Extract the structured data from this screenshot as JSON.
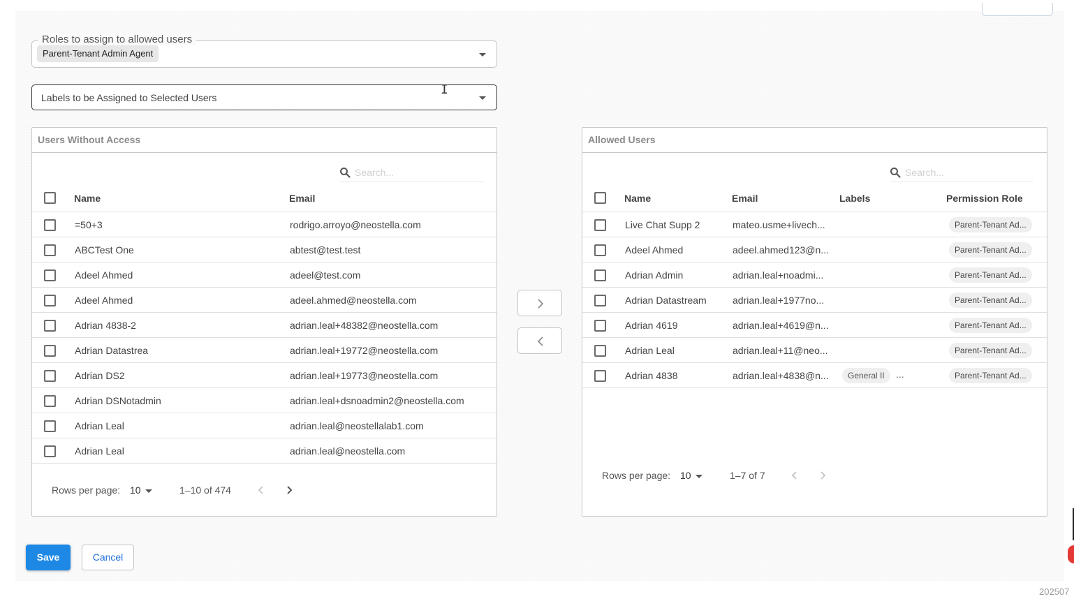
{
  "roles_field": {
    "legend": "Roles to assign to allowed users",
    "selected_chip": "Parent-Tenant Admin Agent"
  },
  "labels_field": {
    "placeholder": "Labels to be Assigned to Selected Users"
  },
  "left_panel": {
    "title": "Users Without Access",
    "search_placeholder": "Search...",
    "columns": [
      "Name",
      "Email"
    ],
    "rows": [
      {
        "name": "=50+3",
        "email": "rodrigo.arroyo@neostella.com"
      },
      {
        "name": "ABCTest One",
        "email": "abtest@test.test"
      },
      {
        "name": "Adeel Ahmed",
        "email": "adeel@test.com"
      },
      {
        "name": "Adeel Ahmed",
        "email": "adeel.ahmed@neostella.com"
      },
      {
        "name": "Adrian 4838-2",
        "email": "adrian.leal+48382@neostella.com"
      },
      {
        "name": "Adrian Datastrea",
        "email": "adrian.leal+19772@neostella.com"
      },
      {
        "name": "Adrian DS2",
        "email": "adrian.leal+19773@neostella.com"
      },
      {
        "name": "Adrian DSNotadmin",
        "email": "adrian.leal+dsnoadmin2@neostella.com"
      },
      {
        "name": "Adrian Leal",
        "email": "adrian.leal@neostellalab1.com"
      },
      {
        "name": "Adrian Leal",
        "email": "adrian.leal@neostella.com"
      }
    ],
    "rows_per_page_label": "Rows per page:",
    "rows_per_page": "10",
    "range": "1–10 of 474"
  },
  "right_panel": {
    "title": "Allowed Users",
    "search_placeholder": "Search...",
    "columns": [
      "Name",
      "Email",
      "Labels",
      "Permission Role"
    ],
    "rows": [
      {
        "name": "Live Chat Supp 2",
        "email": "mateo.usme+livech...",
        "label": "",
        "role": "Parent-Tenant Ad..."
      },
      {
        "name": "Adeel Ahmed",
        "email": "adeel.ahmed123@n...",
        "label": "",
        "role": "Parent-Tenant Ad..."
      },
      {
        "name": "Adrian Admin",
        "email": "adrian.leal+noadmi...",
        "label": "",
        "role": "Parent-Tenant Ad..."
      },
      {
        "name": "Adrian Datastream",
        "email": "adrian.leal+1977no...",
        "label": "",
        "role": "Parent-Tenant Ad..."
      },
      {
        "name": "Adrian 4619",
        "email": "adrian.leal+4619@n...",
        "label": "",
        "role": "Parent-Tenant Ad..."
      },
      {
        "name": "Adrian Leal",
        "email": "adrian.leal+11@neo...",
        "label": "",
        "role": "Parent-Tenant Ad..."
      },
      {
        "name": "Adrian 4838",
        "email": "adrian.leal+4838@n...",
        "label": "General II",
        "label_more": "...",
        "role": "Parent-Tenant Ad..."
      }
    ],
    "rows_per_page_label": "Rows per page:",
    "rows_per_page": "10",
    "range": "1–7 of 7"
  },
  "transfer": {
    "move_right_icon": "chevron-right-icon",
    "move_left_icon": "chevron-left-icon"
  },
  "footer": {
    "save_label": "Save",
    "cancel_label": "Cancel"
  },
  "corner_stamp": "202507",
  "colors": {
    "primary": "#1e88e5",
    "cancel_text": "#1e6fd9",
    "fab": "#e53935"
  }
}
